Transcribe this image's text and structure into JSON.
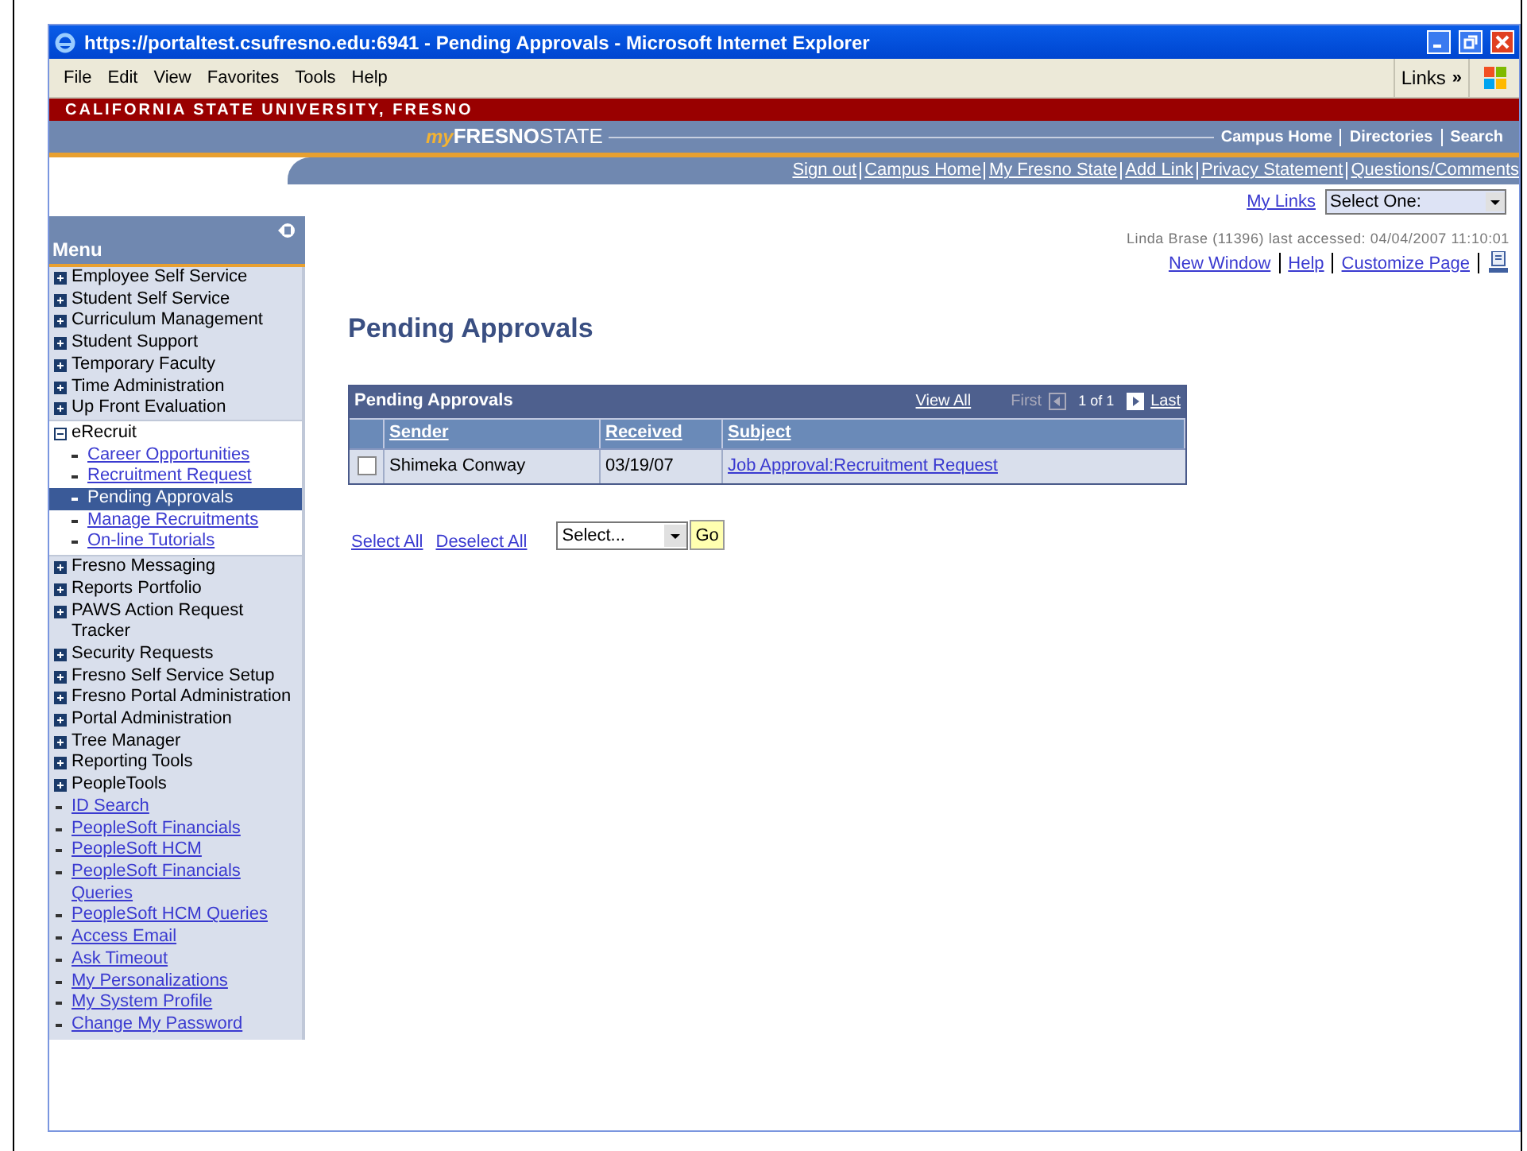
{
  "window": {
    "title": "https://portaltest.csufresno.edu:6941 - Pending Approvals - Microsoft Internet Explorer"
  },
  "menubar": [
    "File",
    "Edit",
    "View",
    "Favorites",
    "Tools",
    "Help"
  ],
  "links_toolbar": {
    "label": "Links",
    "chevron": "»"
  },
  "banner": {
    "university": "CALIFORNIA STATE UNIVERSITY, FRESNO",
    "logo_my": "my",
    "logo_fresno": "FRESNO",
    "logo_state": "STATE",
    "nav": [
      "Campus Home",
      "Directories",
      "Search"
    ]
  },
  "portal_links": [
    "Sign out",
    "Campus Home",
    "My Fresno State",
    "Add Link",
    "Privacy Statement",
    "Questions/Comments"
  ],
  "my_links": {
    "label": "My Links",
    "select": "Select One:"
  },
  "last_accessed": "Linda Brase (11396) last accessed: 04/04/2007 11:10:01",
  "page_links": [
    "New Window",
    "Help",
    "Customize Page"
  ],
  "menu": {
    "title": "Menu",
    "items": [
      {
        "kind": "folder",
        "label": "Employee Self Service"
      },
      {
        "kind": "folder",
        "label": "Student Self Service"
      },
      {
        "kind": "folder",
        "label": "Curriculum Management"
      },
      {
        "kind": "folder",
        "label": "Student Support"
      },
      {
        "kind": "folder",
        "label": "Temporary Faculty"
      },
      {
        "kind": "folder",
        "label": "Time Administration"
      },
      {
        "kind": "folder",
        "label": "Up Front Evaluation"
      },
      {
        "kind": "open",
        "label": "eRecruit",
        "children": [
          {
            "label": "Career Opportunities",
            "selected": false
          },
          {
            "label": "Recruitment Request",
            "selected": false
          },
          {
            "label": "Pending Approvals",
            "selected": true
          },
          {
            "label": "Manage Recruitments",
            "selected": false
          },
          {
            "label": "On-line Tutorials",
            "selected": false
          }
        ]
      },
      {
        "kind": "folder",
        "label": "Fresno Messaging"
      },
      {
        "kind": "folder",
        "label": "Reports Portfolio"
      },
      {
        "kind": "folder",
        "label": "PAWS Action Request Tracker"
      },
      {
        "kind": "folder",
        "label": "Security Requests"
      },
      {
        "kind": "folder",
        "label": "Fresno Self Service Setup"
      },
      {
        "kind": "folder",
        "label": "Fresno Portal Administration"
      },
      {
        "kind": "folder",
        "label": "Portal Administration"
      },
      {
        "kind": "folder",
        "label": "Tree Manager"
      },
      {
        "kind": "folder",
        "label": "Reporting Tools"
      },
      {
        "kind": "folder",
        "label": "PeopleTools"
      },
      {
        "kind": "link",
        "label": "ID Search"
      },
      {
        "kind": "link",
        "label": "PeopleSoft Financials"
      },
      {
        "kind": "link",
        "label": "PeopleSoft HCM"
      },
      {
        "kind": "link",
        "label": "PeopleSoft Financials Queries"
      },
      {
        "kind": "link",
        "label": "PeopleSoft HCM Queries"
      },
      {
        "kind": "link",
        "label": "Access Email"
      },
      {
        "kind": "link",
        "label": "Ask Timeout"
      },
      {
        "kind": "link",
        "label": "My Personalizations"
      },
      {
        "kind": "link",
        "label": "My System Profile"
      },
      {
        "kind": "link",
        "label": "Change My Password"
      }
    ]
  },
  "heading": "Pending Approvals",
  "grid": {
    "title": "Pending Approvals",
    "view_all": "View All",
    "first": "First",
    "count": "1 of 1",
    "last": "Last",
    "columns": [
      "Sender",
      "Received",
      "Subject"
    ],
    "rows": [
      {
        "checked": false,
        "sender": "Shimeka Conway",
        "received": "03/19/07",
        "subject": "Job Approval:Recruitment Request"
      }
    ]
  },
  "actions": {
    "select_all": "Select All",
    "deselect_all": "Deselect All",
    "select": "Select...",
    "go": "Go"
  }
}
